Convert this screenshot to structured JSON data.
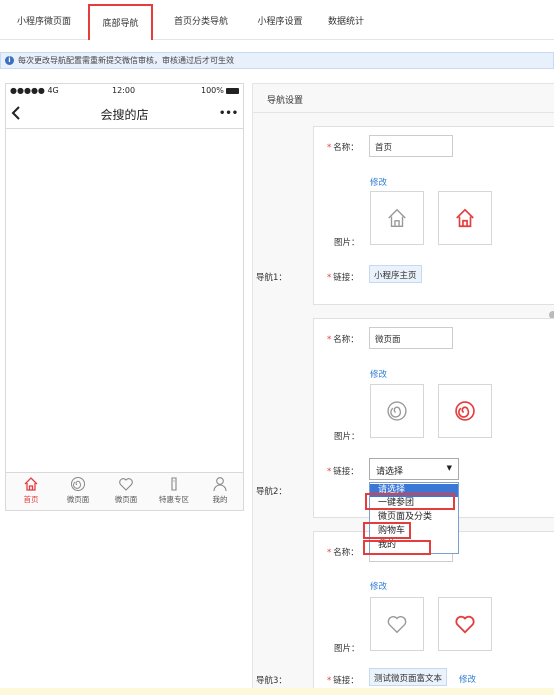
{
  "tabs": [
    {
      "label": "小程序微页面"
    },
    {
      "label": "底部导航"
    },
    {
      "label": "首页分类导航"
    },
    {
      "label": "小程序设置"
    },
    {
      "label": "数据统计"
    }
  ],
  "notice": {
    "icon": "info-icon",
    "text": "每次更改导航配置需重新提交微信审核，审核通过后才可生效"
  },
  "phone": {
    "signal": "●●●●● 4G",
    "time": "12:00",
    "battery": "100%",
    "title": "会搜的店",
    "more": "•••",
    "bottom_items": [
      {
        "label": "首页",
        "icon": "home-icon"
      },
      {
        "label": "微页面",
        "icon": "spiral-icon"
      },
      {
        "label": "微页面",
        "icon": "heart-icon"
      },
      {
        "label": "特惠专区",
        "icon": "tag-icon"
      },
      {
        "label": "我的",
        "icon": "user-icon"
      }
    ]
  },
  "panel": {
    "title": "导航设置",
    "name_label": "名称：",
    "image_label": "图片：",
    "link_label": "链接：",
    "edit_label": "修改",
    "navs": [
      {
        "label": "导航1：",
        "name": "首页",
        "link": "小程序主页"
      },
      {
        "label": "导航2：",
        "name": "微页面",
        "select": "请选择",
        "select_arrow": "▼"
      },
      {
        "label": "导航3：",
        "name": "",
        "link": "测试微页面富文本",
        "link_edit": "修改"
      }
    ],
    "dropdown_options": [
      "请选择",
      "一键参团",
      "微页面及分类",
      "购物车",
      "我的"
    ]
  },
  "colors": {
    "accent": "#e43d3d",
    "link": "#2d7cd6",
    "selected": "#3b78d6"
  }
}
